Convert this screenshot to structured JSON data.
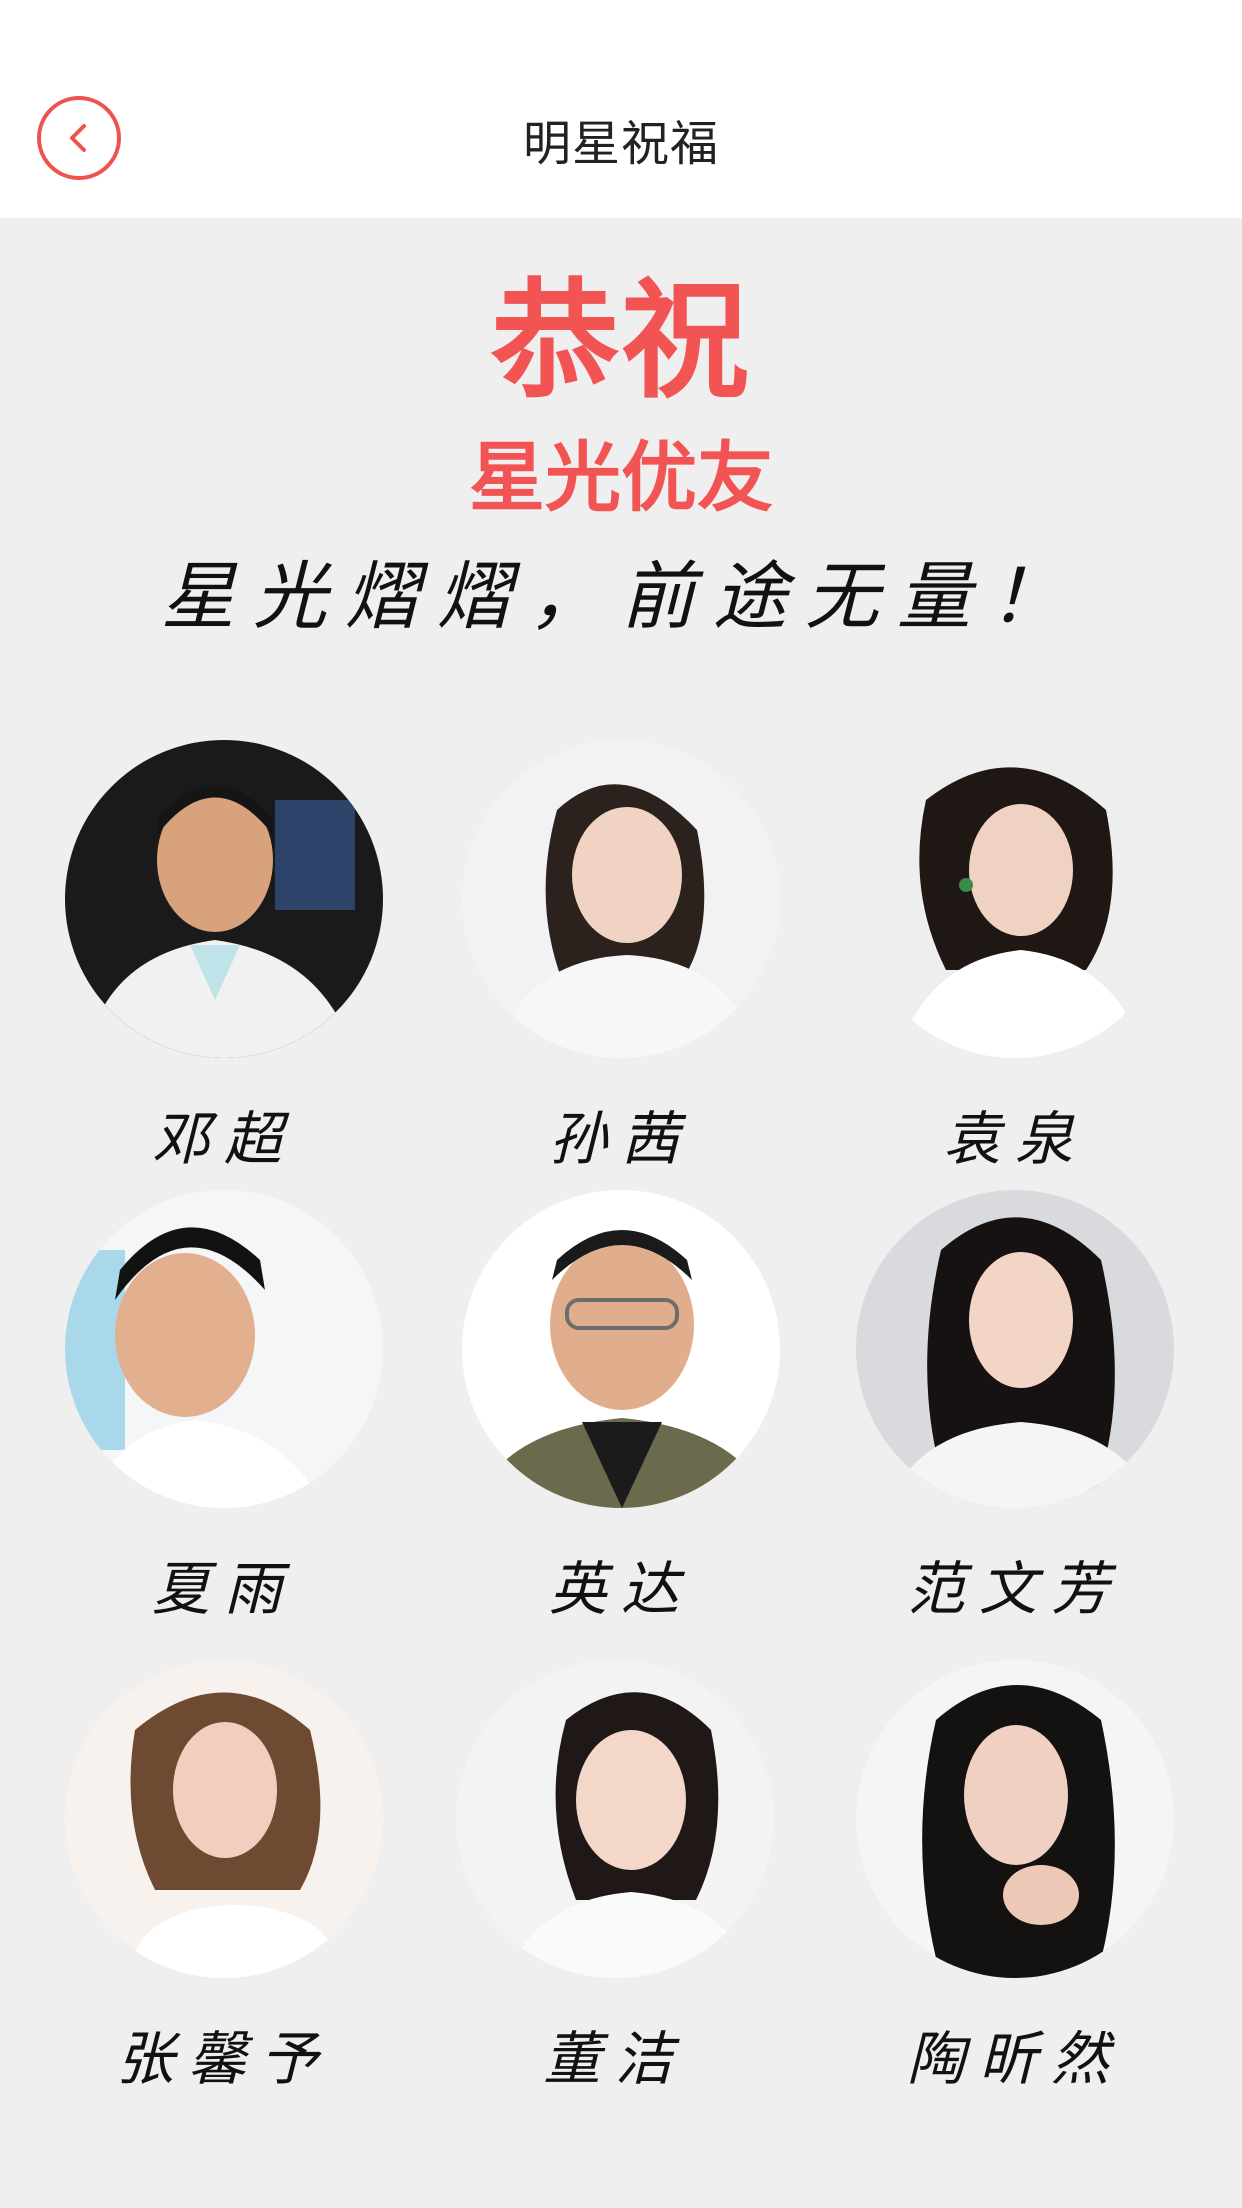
{
  "header": {
    "title": "明星祝福"
  },
  "hero": {
    "congrats": "恭祝",
    "subtitle": "星光优友",
    "motto": "星光熠熠，前途无量！"
  },
  "celebrities": [
    {
      "name": "邓超"
    },
    {
      "name": "孙茜"
    },
    {
      "name": "袁泉"
    },
    {
      "name": "夏雨"
    },
    {
      "name": "英达"
    },
    {
      "name": "范文芳"
    },
    {
      "name": "张馨予"
    },
    {
      "name": "董洁"
    },
    {
      "name": "陶昕然"
    }
  ],
  "colors": {
    "accent": "#f25454",
    "header_bg": "#ffffff",
    "page_bg": "#efefef"
  },
  "icons": {
    "back": "chevron-left-icon"
  }
}
